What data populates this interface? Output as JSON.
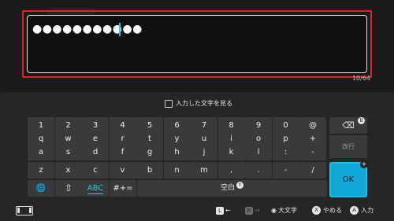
{
  "input": {
    "masked_value": "●●●●●●●●●●●",
    "char_count": "10/64"
  },
  "show_text_label": "入力した文字を見る",
  "keys": {
    "row1": [
      "1",
      "2",
      "3",
      "4",
      "5",
      "6",
      "7",
      "8",
      "9",
      "0",
      "@"
    ],
    "row2": [
      "q",
      "w",
      "e",
      "r",
      "t",
      "y",
      "u",
      "i",
      "o",
      "p",
      "+"
    ],
    "row3": [
      "a",
      "s",
      "d",
      "f",
      "g",
      "h",
      "j",
      "k",
      "l",
      ":",
      "-"
    ],
    "row4": [
      "z",
      "x",
      "c",
      "v",
      "b",
      "n",
      "m",
      ",",
      ".",
      "-",
      "/"
    ],
    "globe": "🌐",
    "shift": "⇧",
    "abc": "ABC",
    "symbols": "#+=",
    "space": "空白",
    "space_badge": "Y",
    "backspace_icon": "⌫",
    "backspace_badge": "B",
    "newline": "改行",
    "ok": "OK",
    "ok_badge": "+"
  },
  "footer": {
    "l_key": "L",
    "left_arrow": "←",
    "r_key": "R",
    "right_arrow": "→",
    "stick_icon": "◉",
    "uppercase": "大文字",
    "x_key": "X",
    "cancel": "やめる",
    "a_key": "A",
    "enter": "入力"
  }
}
